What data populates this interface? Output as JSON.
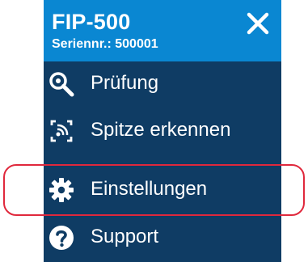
{
  "header": {
    "device_name": "FIP-500",
    "serial_text": "Seriennr.: 500001"
  },
  "menu": {
    "items": [
      {
        "label": "Prüfung",
        "icon": "magnifier-icon"
      },
      {
        "label": "Spitze erkennen",
        "icon": "tip-detect-icon"
      },
      {
        "label": "Einstellungen",
        "icon": "gear-icon"
      },
      {
        "label": "Support",
        "icon": "help-icon"
      }
    ]
  },
  "colors": {
    "header_bg": "#0a87d2",
    "panel_bg": "#0f3c64",
    "highlight": "#e0283c",
    "text": "#ffffff"
  },
  "highlighted_item": "Einstellungen"
}
